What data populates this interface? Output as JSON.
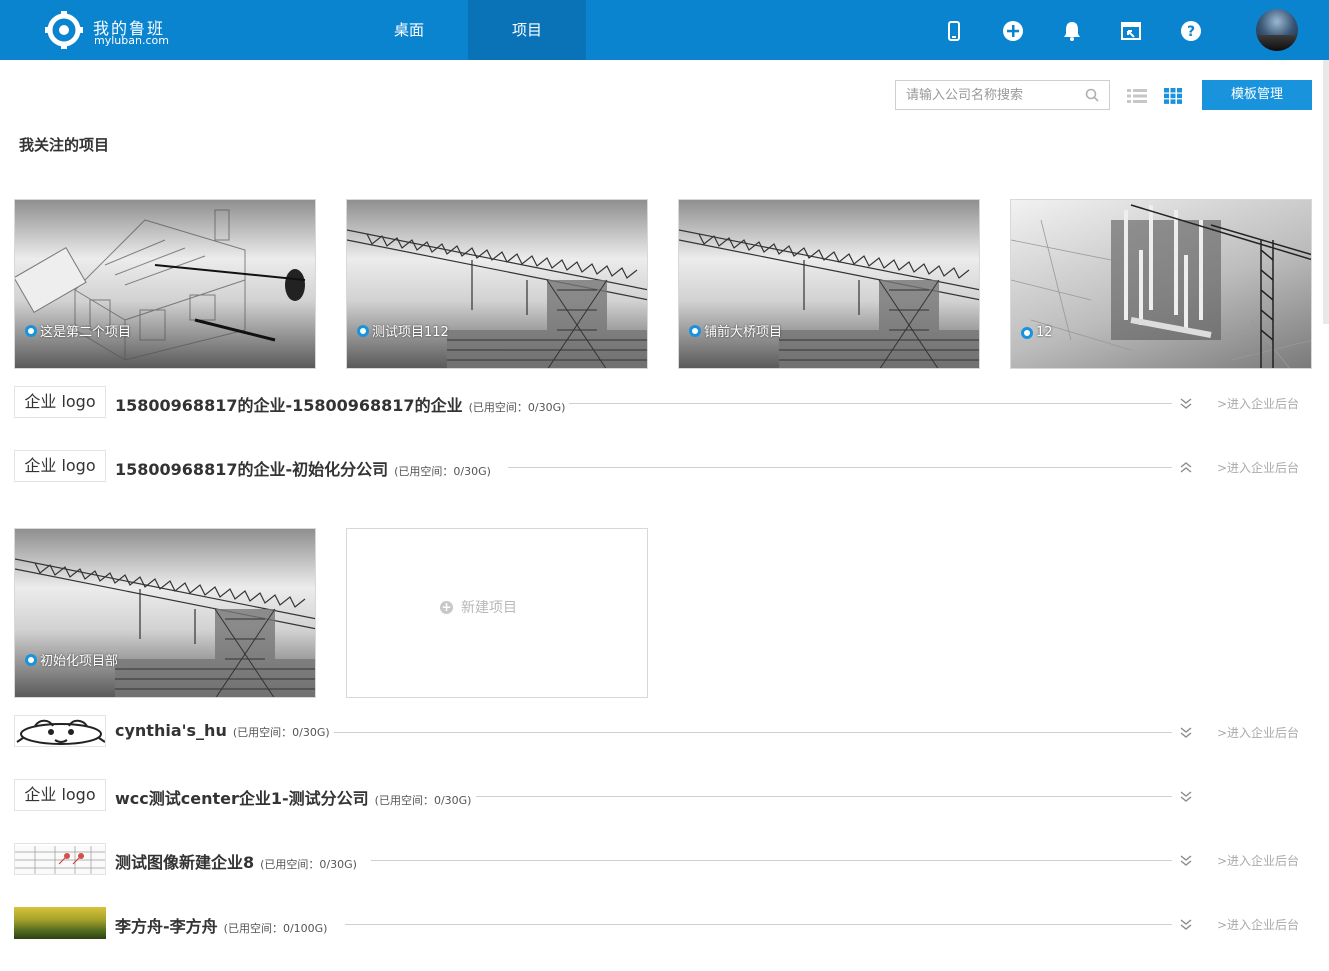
{
  "header": {
    "brand_title": "我的鲁班",
    "brand_sub": "myluban.com",
    "nav": [
      {
        "label": "桌面",
        "active": false
      },
      {
        "label": "项目",
        "active": true
      }
    ],
    "icons": [
      "mobile-icon",
      "plus-icon",
      "bell-icon",
      "window-icon",
      "help-icon"
    ]
  },
  "toolbar": {
    "search_placeholder": "请输入公司名称搜索",
    "template_button": "模板管理"
  },
  "section_title": "我关注的项目",
  "followed_projects": [
    {
      "name": "这是第二个项目",
      "image": "house"
    },
    {
      "name": "测试项目112",
      "image": "crane"
    },
    {
      "name": "铺前大桥项目",
      "image": "crane"
    },
    {
      "name": "12",
      "image": "tower"
    }
  ],
  "companies": [
    {
      "logo": "企业  logo",
      "name": "15800968817的企业-15800968817的企业",
      "quota": "(已用空间：0/30G)",
      "enter": ">进入企业后台",
      "expanded": false
    },
    {
      "logo": "企业  logo",
      "name": "15800968817的企业-初始化分公司",
      "quota": "(已用空间：0/30G)",
      "enter": ">进入企业后台",
      "expanded": true,
      "projects": [
        {
          "name": "初始化项目部"
        }
      ],
      "new_project": "新建项目"
    },
    {
      "logo": "",
      "name": "cynthia's_hu",
      "quota": "(已用空间：0/30G)",
      "enter": ">进入企业后台",
      "expanded": false
    },
    {
      "logo": "企业  logo",
      "name": "wcc测试center企业1-测试分公司",
      "quota": "(已用空间：0/30G)",
      "enter": "",
      "expanded": false
    },
    {
      "logo": "",
      "name": "测试图像新建企业8",
      "quota": "(已用空间：0/30G)",
      "enter": ">进入企业后台",
      "expanded": false
    },
    {
      "logo": "",
      "name": "李方舟-李方舟",
      "quota": "(已用空间：0/100G)",
      "enter": ">进入企业后台",
      "expanded": false
    }
  ],
  "colors": {
    "header": "#0b84d0",
    "accent": "#1a93dd"
  }
}
